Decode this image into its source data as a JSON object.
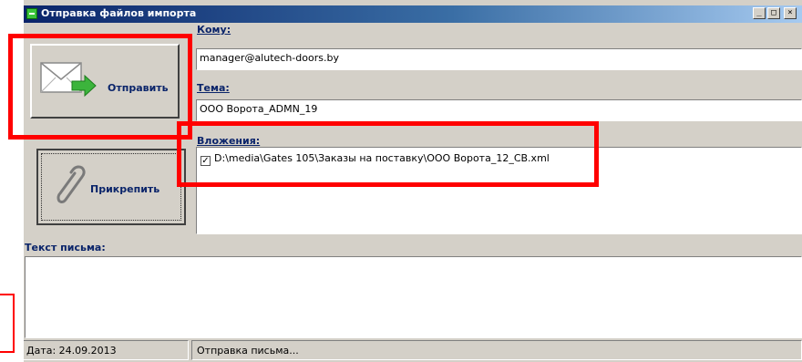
{
  "window": {
    "title": "Отправка файлов импорта"
  },
  "titlebar_buttons": {
    "minimize": "_",
    "maximize": "□",
    "close": "×"
  },
  "send_button": {
    "label": "Отправить",
    "icon": "envelope-send-icon"
  },
  "attach_button": {
    "label": "Прикрепить",
    "icon": "paperclip-icon"
  },
  "to": {
    "label": "Кому:",
    "value": "manager@alutech-doors.by"
  },
  "subject": {
    "label": "Тема:",
    "value": "ООО Ворота_ADMN_19"
  },
  "attachments": {
    "label": "Вложения:",
    "items": [
      {
        "checked": true,
        "path": "D:\\media\\Gates 105\\Заказы на поставку\\ООО Ворота_12_СВ.xml"
      }
    ]
  },
  "body": {
    "label": "Текст письма:",
    "value": ""
  },
  "status": {
    "date": "Дата: 24.09.2013",
    "message": "Отправка письма..."
  },
  "colors": {
    "highlight": "#ff0000",
    "window_bg": "#d4d0c8",
    "title_blue": "#0a246a"
  }
}
